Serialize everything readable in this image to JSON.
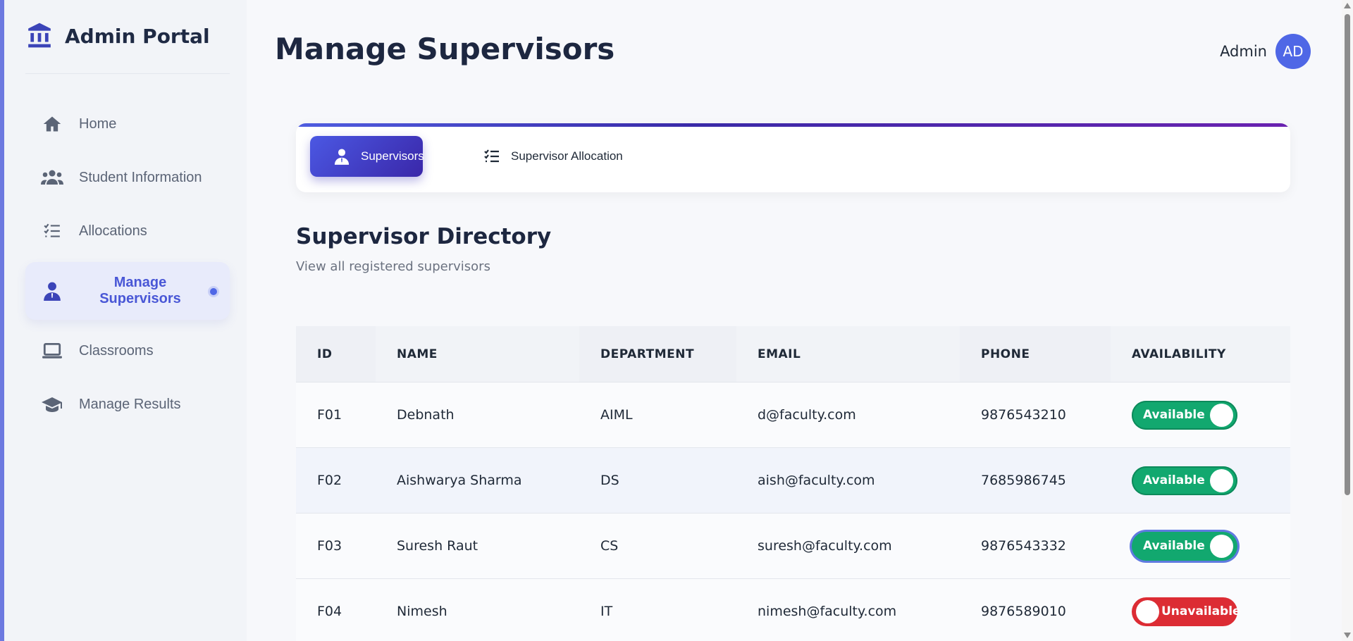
{
  "brand": {
    "title": "Admin Portal",
    "icon": "bank-icon"
  },
  "sidebar": {
    "items": [
      {
        "label": "Home",
        "icon": "home-icon"
      },
      {
        "label": "Student Information",
        "icon": "users-icon"
      },
      {
        "label": "Allocations",
        "icon": "checklist-icon"
      },
      {
        "label": "Manage Supervisors",
        "icon": "supervisor-icon",
        "active": true
      },
      {
        "label": "Classrooms",
        "icon": "laptop-icon"
      },
      {
        "label": "Manage Results",
        "icon": "graduation-cap-icon"
      }
    ]
  },
  "header": {
    "title": "Manage Supervisors",
    "user_name": "Admin",
    "avatar_initials": "AD"
  },
  "tabs": [
    {
      "label": "Supervisors",
      "icon": "supervisor-icon",
      "active": true
    },
    {
      "label": "Supervisor Allocation",
      "icon": "checklist-icon",
      "active": false
    }
  ],
  "directory": {
    "title": "Supervisor Directory",
    "subtitle": "View all registered supervisors"
  },
  "table": {
    "columns": [
      "ID",
      "NAME",
      "DEPARTMENT",
      "EMAIL",
      "PHONE",
      "AVAILABILITY"
    ],
    "rows": [
      {
        "id": "F01",
        "name": "Debnath",
        "department": "AIML",
        "email": "d@faculty.com",
        "phone": "9876543210",
        "availability": "Available"
      },
      {
        "id": "F02",
        "name": "Aishwarya Sharma",
        "department": "DS",
        "email": "aish@faculty.com",
        "phone": "7685986745",
        "availability": "Available"
      },
      {
        "id": "F03",
        "name": "Suresh Raut",
        "department": "CS",
        "email": "suresh@faculty.com",
        "phone": "9876543332",
        "availability": "Available"
      },
      {
        "id": "F04",
        "name": "Nimesh",
        "department": "IT",
        "email": "nimesh@faculty.com",
        "phone": "9876589010",
        "availability": "Unavailable"
      }
    ]
  },
  "colors": {
    "accent": "#4f67e6",
    "available": "#12a86f",
    "unavailable": "#dc2c34"
  }
}
